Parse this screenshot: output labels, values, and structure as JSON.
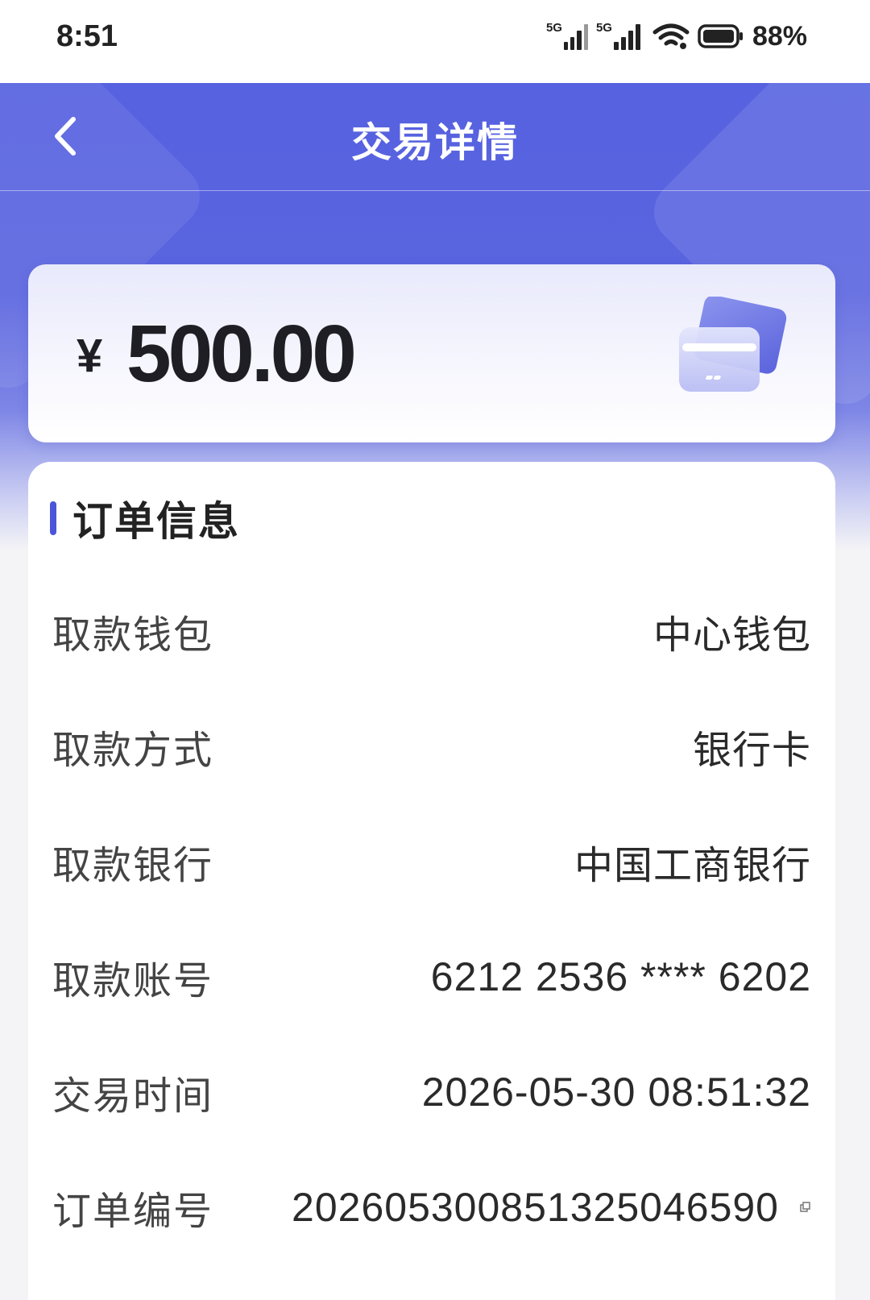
{
  "status_bar": {
    "time": "8:51",
    "network_1": "5G",
    "network_2": "5G",
    "battery": "88%",
    "icons": [
      "signal-icon",
      "signal-icon",
      "wifi-icon",
      "battery-icon"
    ]
  },
  "nav": {
    "title": "交易详情",
    "back_icon": "chevron-left-icon"
  },
  "amount": {
    "currency": "¥",
    "value": "500.00",
    "icon": "bank-card-icon"
  },
  "order": {
    "section_title": "订单信息",
    "rows": [
      {
        "label": "取款钱包",
        "value": "中心钱包"
      },
      {
        "label": "取款方式",
        "value": "银行卡"
      },
      {
        "label": "取款银行",
        "value": "中国工商银行"
      },
      {
        "label": "取款账号",
        "value": "6212 2536 **** 6202"
      },
      {
        "label": "交易时间",
        "value": "2026-05-30 08:51:32"
      },
      {
        "label": "订单编号",
        "value": "20260530085132504659​0"
      }
    ],
    "copy_icon": "copy-icon"
  },
  "colors": {
    "accent": "#4a55d9",
    "header_blue": "#5662e0",
    "text_primary": "#222222",
    "text_label": "#444444",
    "background": "#f4f4f6"
  }
}
